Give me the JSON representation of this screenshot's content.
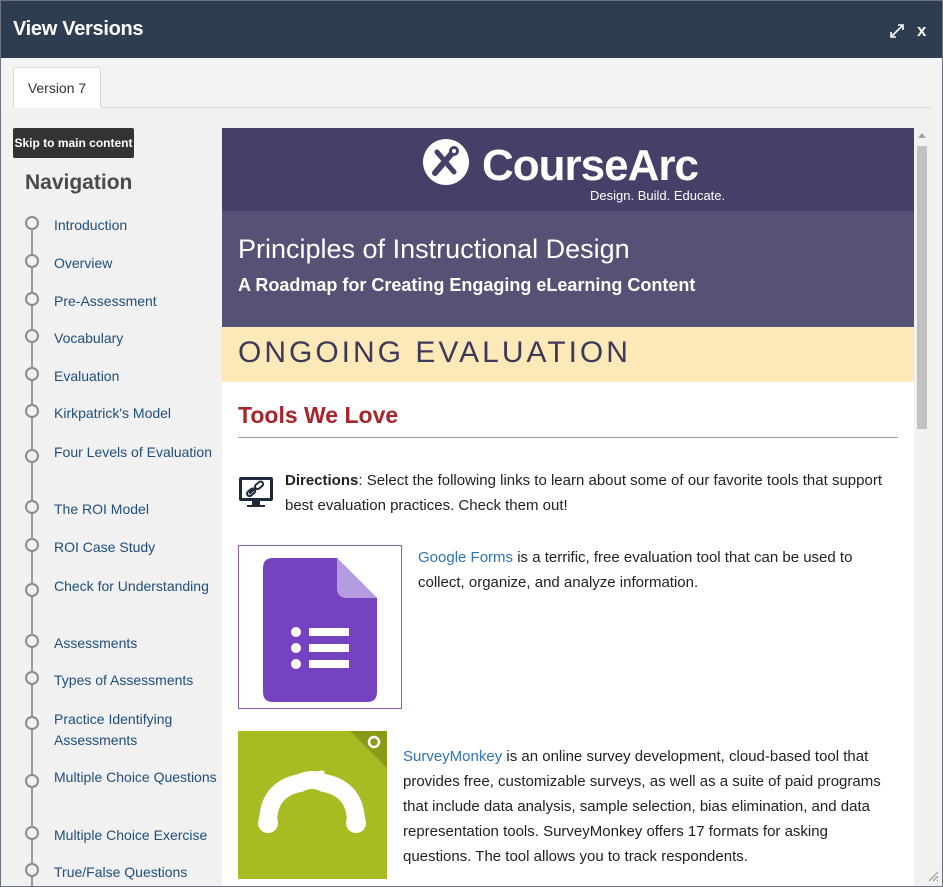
{
  "dialog": {
    "title": "View Versions",
    "close_label": "x",
    "tab_label": "Version 7"
  },
  "skip_link": "Skip to main content",
  "nav": {
    "heading": "Navigation",
    "items": [
      "Introduction",
      "Overview",
      "Pre-Assessment",
      "Vocabulary",
      "Evaluation",
      "Kirkpatrick's Model",
      "Four Levels of Evaluation",
      "The ROI Model",
      "ROI Case Study",
      "Check for Understanding",
      "Assessments",
      "Types of Assessments",
      "Practice Identifying Assessments",
      "Multiple Choice Questions",
      "Multiple Choice Exercise",
      "True/False Questions"
    ]
  },
  "page": {
    "brand_name": "CourseArc",
    "brand_tagline": "Design. Build. Educate.",
    "course_title": "Principles of Instructional Design",
    "course_subtitle": "A Roadmap for Creating Engaging eLearning Content",
    "section_title": "ONGOING EVALUATION",
    "heading": "Tools We Love",
    "directions_label": "Directions",
    "directions_text": ": Select the following links to learn about some of our favorite tools that support best evaluation practices. Check them out!",
    "gforms_link": "Google Forms",
    "gforms_text": " is a terrific, free evaluation tool that can be used to collect, organize, and analyze information.",
    "surveymonkey_link": "SurveyMonkey",
    "surveymonkey_text": " is an online survey development, cloud-based tool that provides free, customizable surveys, as well as a suite of paid programs that include data analysis, sample selection, bias elimination, and data representation tools. SurveyMonkey offers 17 formats for asking questions. The tool allows you to track respondents."
  },
  "colors": {
    "titlebar": "#2e3e50",
    "brand_band": "#463f68",
    "course_band": "#555275",
    "section_band": "#fde9b8",
    "heading": "#a8242b",
    "link": "#2e73b3",
    "nav_link": "#1f4e7a"
  },
  "icons": [
    "expand-icon",
    "close-icon",
    "coursearc-logo-icon",
    "directions-link-icon",
    "google-forms-icon",
    "surveymonkey-icon",
    "resize-grip-icon"
  ]
}
